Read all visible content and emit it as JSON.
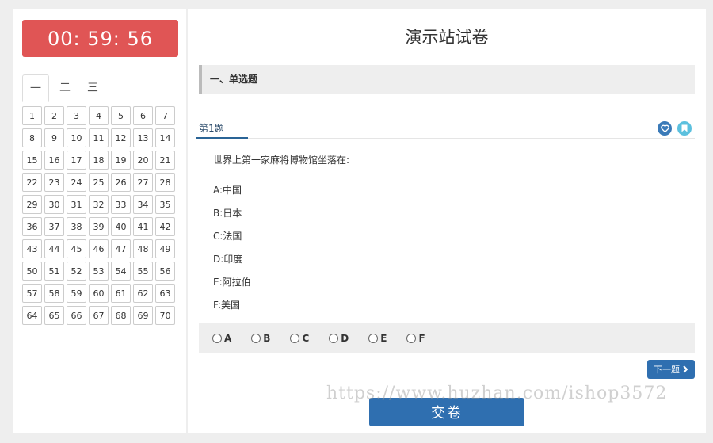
{
  "timer": "00: 59: 56",
  "tabs": [
    "一",
    "二",
    "三"
  ],
  "question_numbers": [
    "1",
    "2",
    "3",
    "4",
    "5",
    "6",
    "7",
    "8",
    "9",
    "10",
    "11",
    "12",
    "13",
    "14",
    "15",
    "16",
    "17",
    "18",
    "19",
    "20",
    "21",
    "22",
    "23",
    "24",
    "25",
    "26",
    "27",
    "28",
    "29",
    "30",
    "31",
    "32",
    "33",
    "34",
    "35",
    "36",
    "37",
    "38",
    "39",
    "40",
    "41",
    "42",
    "43",
    "44",
    "45",
    "46",
    "47",
    "48",
    "49",
    "50",
    "51",
    "52",
    "53",
    "54",
    "55",
    "56",
    "57",
    "58",
    "59",
    "60",
    "61",
    "62",
    "63",
    "64",
    "65",
    "66",
    "67",
    "68",
    "69",
    "70"
  ],
  "exam": {
    "title": "演示站试卷",
    "section": "一、单选题",
    "question_label": "第1题",
    "question_text": "世界上第一家麻将博物馆坐落在:",
    "options": [
      "A:中国",
      "B:日本",
      "C:法国",
      "D:印度",
      "E:阿拉伯",
      "F:美国"
    ],
    "answers": [
      "A",
      "B",
      "C",
      "D",
      "E",
      "F"
    ],
    "next_label": "下一题",
    "submit_label": "交卷"
  },
  "colors": {
    "timer_bg": "#e05555",
    "primary": "#2f6fb0",
    "heart": "#3a7ab8",
    "mark": "#5bc0de"
  },
  "icons": [
    "heart-icon",
    "bookmark-icon",
    "chevron-right-icon"
  ],
  "watermark": "https://www.huzhan.com/ishop3572"
}
